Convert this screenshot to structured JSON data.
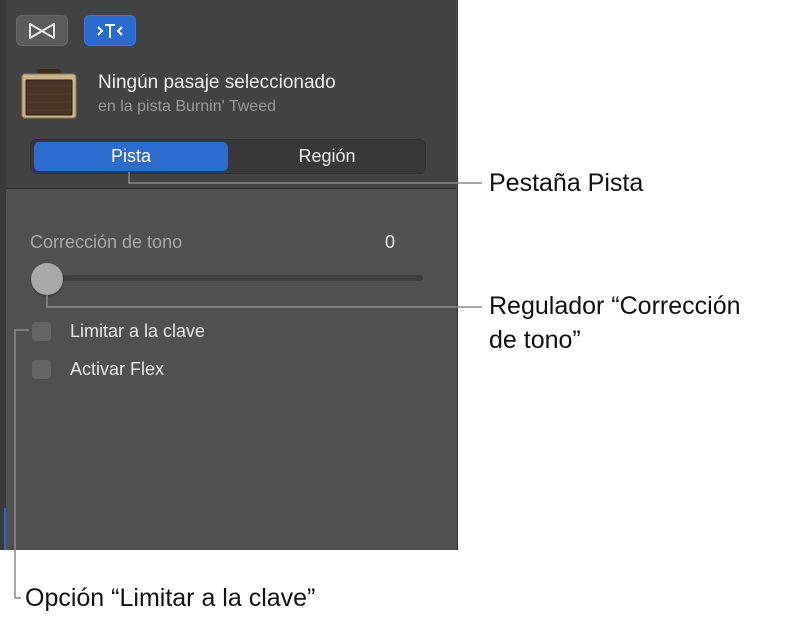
{
  "toolbar": {
    "buttons": [
      {
        "icon": "bowtie-icon",
        "active": false
      },
      {
        "icon": "smart-controls-icon",
        "active": true
      }
    ]
  },
  "header": {
    "icon": "amplifier-icon",
    "title": "Ningún pasaje seleccionado",
    "subtitle": "en la pista Burnin' Tweed"
  },
  "tabs": [
    {
      "label": "Pista",
      "selected": true
    },
    {
      "label": "Región",
      "selected": false
    }
  ],
  "pitch_correction": {
    "label": "Corrección de tono",
    "value": "0",
    "slider_fraction": 0
  },
  "options": [
    {
      "label": "Limitar a la clave",
      "checked": false
    },
    {
      "label": "Activar Flex",
      "checked": false
    }
  ],
  "callouts": {
    "track_tab": "Pestaña Pista",
    "pitch_slider_line1": "Regulador “Corrección",
    "pitch_slider_line2": "de tono”",
    "limit_key_option": "Opción “Limitar a la clave”"
  },
  "colors": {
    "accent": "#2c6ccf",
    "panel": "#505050",
    "panel_header": "#424242"
  }
}
